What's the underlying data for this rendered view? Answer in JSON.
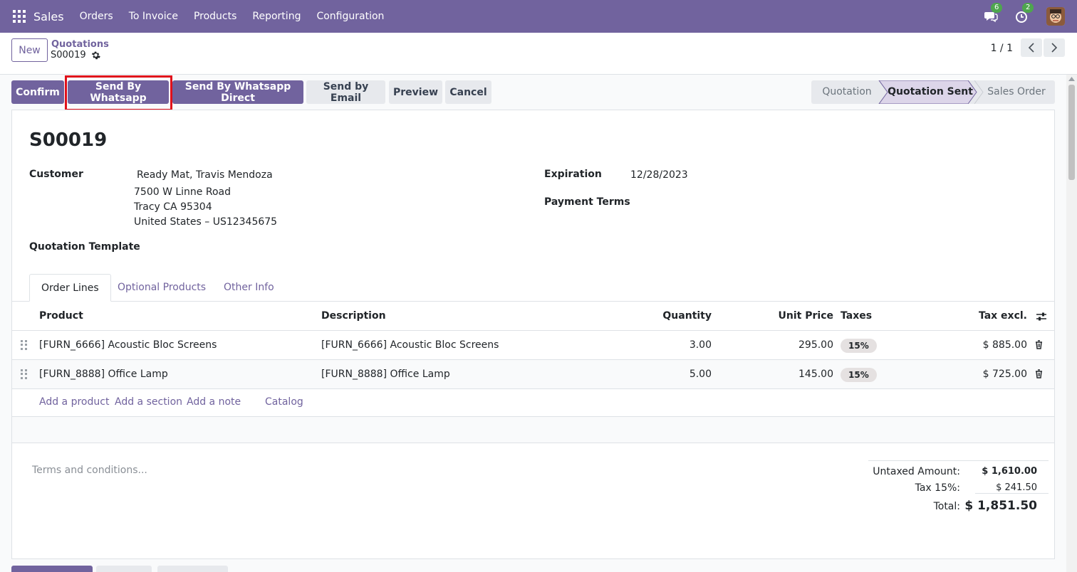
{
  "navbar": {
    "brand": "Sales",
    "menu": [
      "Orders",
      "To Invoice",
      "Products",
      "Reporting",
      "Configuration"
    ],
    "messages_count": "6",
    "activities_count": "2"
  },
  "control_panel": {
    "new_label": "New",
    "breadcrumb": "Quotations",
    "record_name": "S00019",
    "pager": "1 / 1"
  },
  "actions": {
    "confirm": "Confirm",
    "send_whatsapp": "Send By Whatsapp",
    "send_whatsapp_direct": "Send By Whatsapp Direct",
    "send_email": "Send by Email",
    "preview": "Preview",
    "cancel": "Cancel"
  },
  "statusbar": {
    "stages": [
      "Quotation",
      "Quotation Sent",
      "Sales Order"
    ],
    "active": "Quotation Sent"
  },
  "form": {
    "title": "S00019",
    "customer_label": "Customer",
    "customer_name": "Ready Mat, Travis Mendoza",
    "customer_address_1": "7500 W Linne Road",
    "customer_address_2": "Tracy CA 95304",
    "customer_address_3": "United States – US12345675",
    "expiration_label": "Expiration",
    "expiration_value": "12/28/2023",
    "payment_terms_label": "Payment Terms",
    "template_label": "Quotation Template"
  },
  "tabs": [
    "Order Lines",
    "Optional Products",
    "Other Info"
  ],
  "table": {
    "headers": {
      "product": "Product",
      "description": "Description",
      "quantity": "Quantity",
      "unit_price": "Unit Price",
      "taxes": "Taxes",
      "tax_excl": "Tax excl."
    },
    "rows": [
      {
        "product": "[FURN_6666] Acoustic Bloc Screens",
        "description": "[FURN_6666] Acoustic Bloc Screens",
        "quantity": "3.00",
        "unit_price": "295.00",
        "tax": "15%",
        "subtotal": "$ 885.00"
      },
      {
        "product": "[FURN_8888] Office Lamp",
        "description": "[FURN_8888] Office Lamp",
        "quantity": "5.00",
        "unit_price": "145.00",
        "tax": "15%",
        "subtotal": "$ 725.00"
      }
    ],
    "add_links": [
      "Add a product",
      "Add a section",
      "Add a note",
      "Catalog"
    ]
  },
  "footer": {
    "terms_placeholder": "Terms and conditions...",
    "untaxed_label": "Untaxed Amount:",
    "untaxed_value": "$ 1,610.00",
    "tax_label": "Tax 15%:",
    "tax_value": "$ 241.50",
    "total_label": "Total:",
    "total_value": "$ 1,851.50"
  },
  "colors": {
    "brand": "#71639e",
    "highlight": "#e0101b",
    "badge": "#4ea64e"
  }
}
